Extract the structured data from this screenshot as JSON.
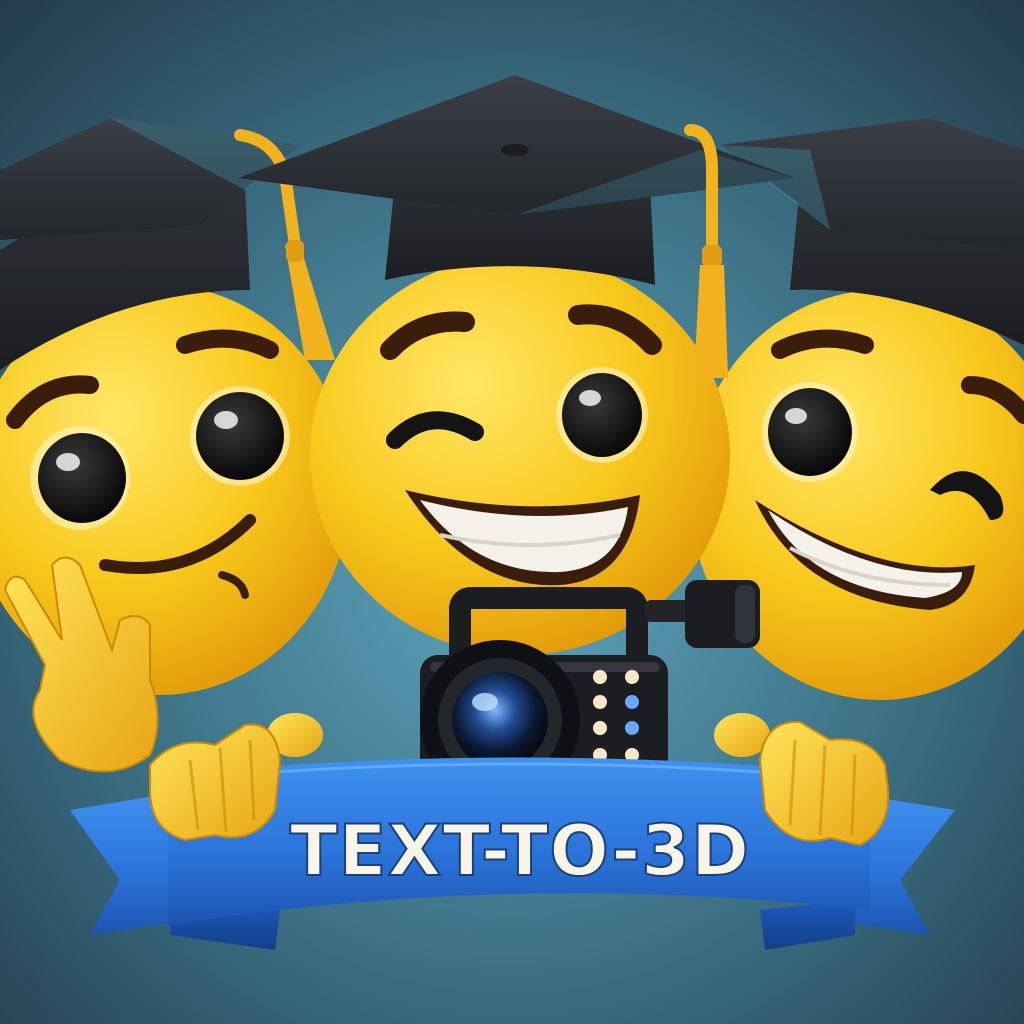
{
  "scene": {
    "description_role": "illustration",
    "banner": {
      "text": "TEXT-TO-3D"
    },
    "colors": {
      "background_center": "#4f8fa6",
      "background_edge": "#243d4c",
      "emoji_face": "#f7c51a",
      "emoji_shadow": "#e29a0c",
      "cap": "#2b2e33",
      "tassel": "#f0b21d",
      "banner": "#2f7fe0",
      "banner_dark": "#1c55ad",
      "banner_text": "#f8f4e6",
      "camera_body": "#1c1d21"
    },
    "icons": [
      "graduation-cap-icon",
      "video-camera-icon",
      "peace-sign-hand-icon",
      "smiley-face-icon"
    ]
  }
}
